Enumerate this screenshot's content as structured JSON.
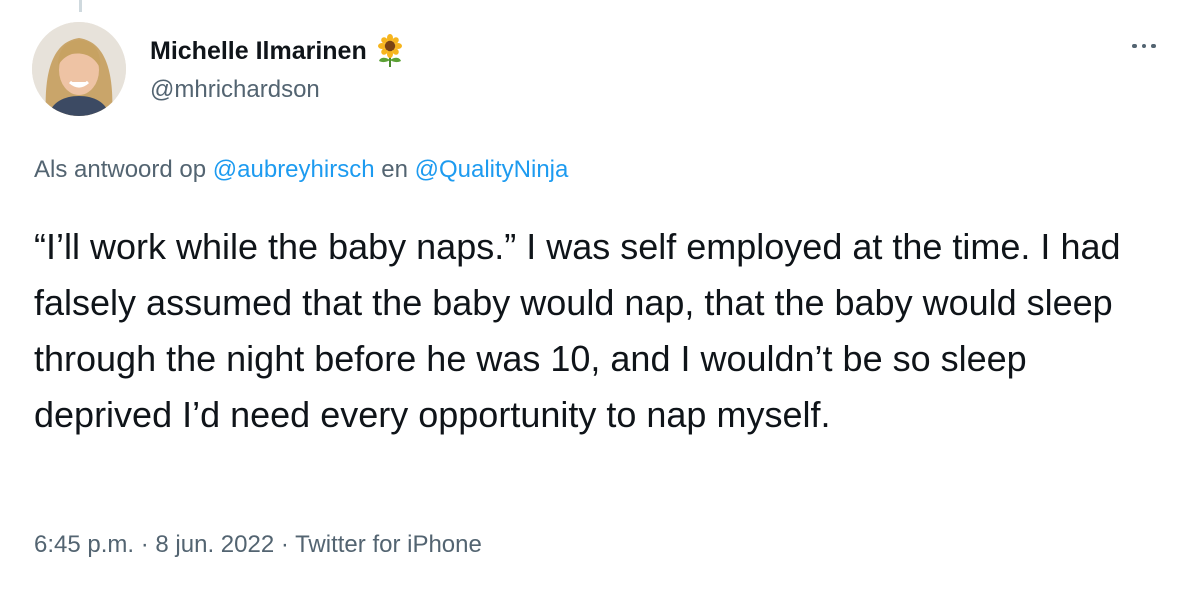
{
  "author": {
    "display_name": "Michelle Ilmarinen",
    "name_emoji_icon": "sunflower-icon",
    "handle": "@mhrichardson"
  },
  "more_menu_icon": "ellipsis-icon",
  "reply_context": {
    "prefix": "Als antwoord op",
    "mention_1": "@aubreyhirsch",
    "conjunction": "en",
    "mention_2": "@QualityNinja"
  },
  "tweet": {
    "text": "“I’ll work while the baby naps.” I was self employed at the time. I had falsely assumed that the baby would nap, that the baby would sleep through the night before he was 10, and I wouldn’t be so sleep deprived I’d need every opportunity to nap myself."
  },
  "meta": {
    "time": "6:45 p.m.",
    "separator": "·",
    "date": "8 jun. 2022",
    "source": "Twitter for iPhone"
  },
  "colors": {
    "link": "#1d9bf0",
    "secondary_text": "#536471",
    "primary_text": "#0f1419"
  }
}
